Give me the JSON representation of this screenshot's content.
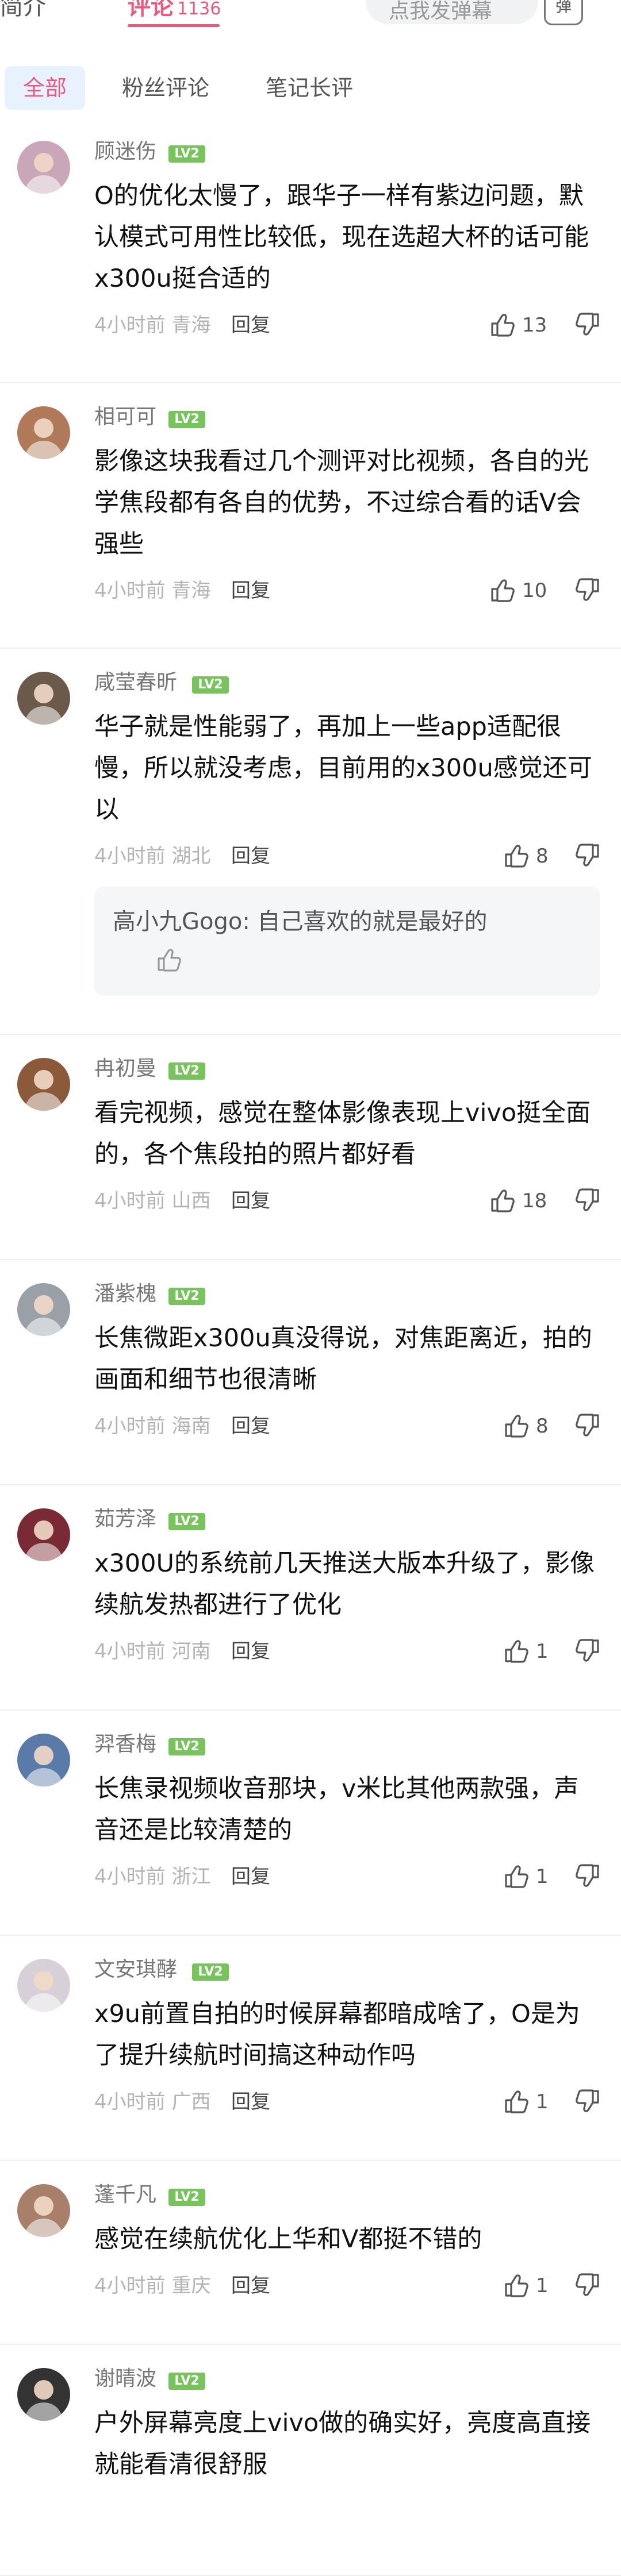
{
  "tabs": {
    "intro": "简介",
    "comments": "评论",
    "comments_count": "1136"
  },
  "danmaku": {
    "placeholder": "点我发弹幕",
    "button": "弹"
  },
  "filters": {
    "all": "全部",
    "fans": "粉丝评论",
    "long": "笔记长评"
  },
  "comments": [
    {
      "name": "顾迷伤",
      "level": "LV2",
      "text": "O的优化太慢了，跟华子一样有紫边问题，默认模式可用性比较低，现在选超大杯的话可能x300u挺合适的",
      "time": "4小时前",
      "location": "青海",
      "reply": "回复",
      "likes": "13",
      "avatar_color": "#c9a6b8"
    },
    {
      "name": "相可可",
      "level": "LV2",
      "text": "影像这块我看过几个测评对比视频，各自的光学焦段都有各自的优势，不过综合看的话V会强些",
      "time": "4小时前",
      "location": "青海",
      "reply": "回复",
      "likes": "10",
      "avatar_color": "#b07a5a"
    },
    {
      "name": "咸莹春昕",
      "level": "LV2",
      "text": "华子就是性能弱了，再加上一些app适配很慢，所以就没考虑，目前用的x300u感觉还可以",
      "time": "4小时前",
      "location": "湖北",
      "reply": "回复",
      "likes": "8",
      "avatar_color": "#6b5a4a",
      "subreply": {
        "author": "高小九Gogo",
        "text": "自己喜欢的就是最好的"
      }
    },
    {
      "name": "冉初曼",
      "level": "LV2",
      "text": "看完视频，感觉在整体影像表现上vivo挺全面的，各个焦段拍的照片都好看",
      "time": "4小时前",
      "location": "山西",
      "reply": "回复",
      "likes": "18",
      "avatar_color": "#8a5a3a"
    },
    {
      "name": "潘紫槐",
      "level": "LV2",
      "text": "长焦微距x300u真没得说，对焦距离近，拍的画面和细节也很清晰",
      "time": "4小时前",
      "location": "海南",
      "reply": "回复",
      "likes": "8",
      "avatar_color": "#9aa0a8"
    },
    {
      "name": "茹芳泽",
      "level": "LV2",
      "text": "x300U的系统前几天推送大版本升级了，影像续航发热都进行了优化",
      "time": "4小时前",
      "location": "河南",
      "reply": "回复",
      "likes": "1",
      "avatar_color": "#7a2a35"
    },
    {
      "name": "羿香梅",
      "level": "LV2",
      "text": "长焦录视频收音那块，v米比其他两款强，声音还是比较清楚的",
      "time": "4小时前",
      "location": "浙江",
      "reply": "回复",
      "likes": "1",
      "avatar_color": "#5a7aa8"
    },
    {
      "name": "文安琪酵",
      "level": "LV2",
      "text": "x9u前置自拍的时候屏幕都暗成啥了，O是为了提升续航时间搞这种动作吗",
      "time": "4小时前",
      "location": "广西",
      "reply": "回复",
      "likes": "1",
      "avatar_color": "#d8d0d8"
    },
    {
      "name": "蓬千凡",
      "level": "LV2",
      "text": "感觉在续航优化上华和V都挺不错的",
      "time": "4小时前",
      "location": "重庆",
      "reply": "回复",
      "likes": "1",
      "avatar_color": "#a8806a"
    },
    {
      "name": "谢晴波",
      "level": "LV2",
      "text": "户外屏幕亮度上vivo做的确实好，亮度高直接就能看清很舒服",
      "time": "",
      "location": "",
      "reply": "",
      "likes": "",
      "avatar_color": "#333333"
    }
  ]
}
